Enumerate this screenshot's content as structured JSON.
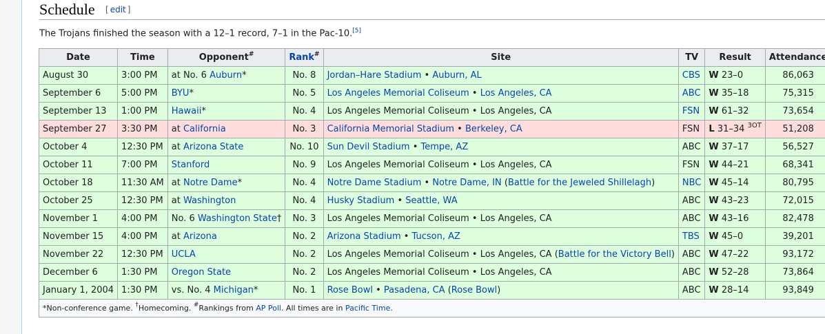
{
  "section": {
    "title": "Schedule",
    "edit_open": "[",
    "edit_label": "edit",
    "edit_close": "]"
  },
  "intro": {
    "text": "The Trojans finished the season with a 12–1 record, 7–1 in the Pac-10.",
    "ref": "[5]"
  },
  "table": {
    "headers": {
      "date": "Date",
      "time": "Time",
      "opponent": "Opponent",
      "opponent_sup": "#",
      "rank": "Rank",
      "rank_sup": "#",
      "site": "Site",
      "tv": "TV",
      "result": "Result",
      "attendance": "Attendance"
    },
    "rows": [
      {
        "date": "August 30",
        "time": "3:00 PM",
        "opp_prefix": "at No. 6 ",
        "opp_link": "Auburn",
        "opp_suffix": "*",
        "rank": "No. 8",
        "site_a": "Jordan–Hare Stadium",
        "site_sep": " • ",
        "site_b": "Auburn, AL",
        "site_extra": "",
        "tv": "CBS",
        "tv_link": true,
        "res_wl": "W",
        "res_score": " 23–0",
        "res_ot": "",
        "att": "86,063",
        "loss": false,
        "site_a_link": true,
        "site_b_link": true
      },
      {
        "date": "September 6",
        "time": "5:00 PM",
        "opp_prefix": "",
        "opp_link": "BYU",
        "opp_suffix": "*",
        "rank": "No. 5",
        "site_a": "Los Angeles Memorial Coliseum",
        "site_sep": " • ",
        "site_b": "Los Angeles, CA",
        "site_extra": "",
        "tv": "ABC",
        "tv_link": true,
        "res_wl": "W",
        "res_score": " 35–18",
        "res_ot": "",
        "att": "75,315",
        "loss": false,
        "site_a_link": true,
        "site_b_link": true
      },
      {
        "date": "September 13",
        "time": "1:00 PM",
        "opp_prefix": "",
        "opp_link": "Hawaii",
        "opp_suffix": "*",
        "rank": "No. 4",
        "site_a": "Los Angeles Memorial Coliseum",
        "site_sep": " • ",
        "site_b": "Los Angeles, CA",
        "site_extra": "",
        "tv": "FSN",
        "tv_link": true,
        "res_wl": "W",
        "res_score": " 61–32",
        "res_ot": "",
        "att": "73,654",
        "loss": false,
        "site_a_link": false,
        "site_b_link": false
      },
      {
        "date": "September 27",
        "time": "3:30 PM",
        "opp_prefix": "at ",
        "opp_link": "California",
        "opp_suffix": "",
        "rank": "No. 3",
        "site_a": "California Memorial Stadium",
        "site_sep": " • ",
        "site_b": "Berkeley, CA",
        "site_extra": "",
        "tv": "FSN",
        "tv_link": false,
        "res_wl": "L",
        "res_score": " 31–34",
        "res_ot": "3OT",
        "att": "51,208",
        "loss": true,
        "site_a_link": true,
        "site_b_link": true
      },
      {
        "date": "October 4",
        "time": "12:30 PM",
        "opp_prefix": "at ",
        "opp_link": "Arizona State",
        "opp_suffix": "",
        "rank": "No. 10",
        "site_a": "Sun Devil Stadium",
        "site_sep": " • ",
        "site_b": "Tempe, AZ",
        "site_extra": "",
        "tv": "ABC",
        "tv_link": false,
        "res_wl": "W",
        "res_score": " 37–17",
        "res_ot": "",
        "att": "56,527",
        "loss": false,
        "site_a_link": true,
        "site_b_link": true
      },
      {
        "date": "October 11",
        "time": "7:00 PM",
        "opp_prefix": "",
        "opp_link": "Stanford",
        "opp_suffix": "",
        "rank": "No. 9",
        "site_a": "Los Angeles Memorial Coliseum",
        "site_sep": " • ",
        "site_b": "Los Angeles, CA",
        "site_extra": "",
        "tv": "FSN",
        "tv_link": false,
        "res_wl": "W",
        "res_score": " 44–21",
        "res_ot": "",
        "att": "68,341",
        "loss": false,
        "site_a_link": false,
        "site_b_link": false
      },
      {
        "date": "October 18",
        "time": "11:30 AM",
        "opp_prefix": "at ",
        "opp_link": "Notre Dame",
        "opp_suffix": "*",
        "rank": "No. 4",
        "site_a": "Notre Dame Stadium",
        "site_sep": " • ",
        "site_b": "Notre Dame, IN",
        "site_extra": "Battle for the Jeweled Shillelagh",
        "tv": "NBC",
        "tv_link": true,
        "res_wl": "W",
        "res_score": " 45–14",
        "res_ot": "",
        "att": "80,795",
        "loss": false,
        "site_a_link": true,
        "site_b_link": true
      },
      {
        "date": "October 25",
        "time": "12:30 PM",
        "opp_prefix": "at ",
        "opp_link": "Washington",
        "opp_suffix": "",
        "rank": "No. 4",
        "site_a": "Husky Stadium",
        "site_sep": " • ",
        "site_b": "Seattle, WA",
        "site_extra": "",
        "tv": "ABC",
        "tv_link": false,
        "res_wl": "W",
        "res_score": " 43–23",
        "res_ot": "",
        "att": "72,015",
        "loss": false,
        "site_a_link": true,
        "site_b_link": true
      },
      {
        "date": "November 1",
        "time": "4:00 PM",
        "opp_prefix": "No. 6 ",
        "opp_link": "Washington State",
        "opp_suffix": "†",
        "rank": "No. 3",
        "site_a": "Los Angeles Memorial Coliseum",
        "site_sep": " • ",
        "site_b": "Los Angeles, CA",
        "site_extra": "",
        "tv": "ABC",
        "tv_link": false,
        "res_wl": "W",
        "res_score": " 43–16",
        "res_ot": "",
        "att": "82,478",
        "loss": false,
        "site_a_link": false,
        "site_b_link": false
      },
      {
        "date": "November 15",
        "time": "4:00 PM",
        "opp_prefix": "at ",
        "opp_link": "Arizona",
        "opp_suffix": "",
        "rank": "No. 2",
        "site_a": "Arizona Stadium",
        "site_sep": " • ",
        "site_b": "Tucson, AZ",
        "site_extra": "",
        "tv": "TBS",
        "tv_link": true,
        "res_wl": "W",
        "res_score": " 45–0",
        "res_ot": "",
        "att": "39,201",
        "loss": false,
        "site_a_link": true,
        "site_b_link": true
      },
      {
        "date": "November 22",
        "time": "12:30 PM",
        "opp_prefix": "",
        "opp_link": "UCLA",
        "opp_suffix": "",
        "rank": "No. 2",
        "site_a": "Los Angeles Memorial Coliseum",
        "site_sep": " • ",
        "site_b": "Los Angeles, CA",
        "site_extra": "Battle for the Victory Bell",
        "tv": "ABC",
        "tv_link": false,
        "res_wl": "W",
        "res_score": " 47–22",
        "res_ot": "",
        "att": "93,172",
        "loss": false,
        "site_a_link": false,
        "site_b_link": false
      },
      {
        "date": "December 6",
        "time": "1:30 PM",
        "opp_prefix": "",
        "opp_link": "Oregon State",
        "opp_suffix": "",
        "rank": "No. 2",
        "site_a": "Los Angeles Memorial Coliseum",
        "site_sep": " • ",
        "site_b": "Los Angeles, CA",
        "site_extra": "",
        "tv": "ABC",
        "tv_link": false,
        "res_wl": "W",
        "res_score": " 52–28",
        "res_ot": "",
        "att": "73,864",
        "loss": false,
        "site_a_link": false,
        "site_b_link": false
      },
      {
        "date": "January 1, 2004",
        "time": "1:30 PM",
        "opp_prefix": "vs. No. 4 ",
        "opp_link": "Michigan",
        "opp_suffix": "*",
        "rank": "No. 1",
        "site_a": "Rose Bowl",
        "site_sep": " • ",
        "site_b": "Pasadena, CA",
        "site_extra": "Rose Bowl",
        "tv": "ABC",
        "tv_link": false,
        "res_wl": "W",
        "res_score": " 28–14",
        "res_ot": "",
        "att": "93,849",
        "loss": false,
        "site_a_link": true,
        "site_b_link": true
      }
    ],
    "footnote": {
      "t1": "*Non-conference game. ",
      "dagger": "†",
      "t2": "Homecoming. ",
      "hash": "#",
      "t3": "Rankings from ",
      "ap_link": "AP Poll",
      "t4": ". All times are in ",
      "tz_link": "Pacific Time",
      "t5": "."
    }
  },
  "colors": {
    "win_row": "#ddffdd",
    "loss_row": "#ffdddd",
    "header": "#eaecf0",
    "link": "#0645ad"
  }
}
